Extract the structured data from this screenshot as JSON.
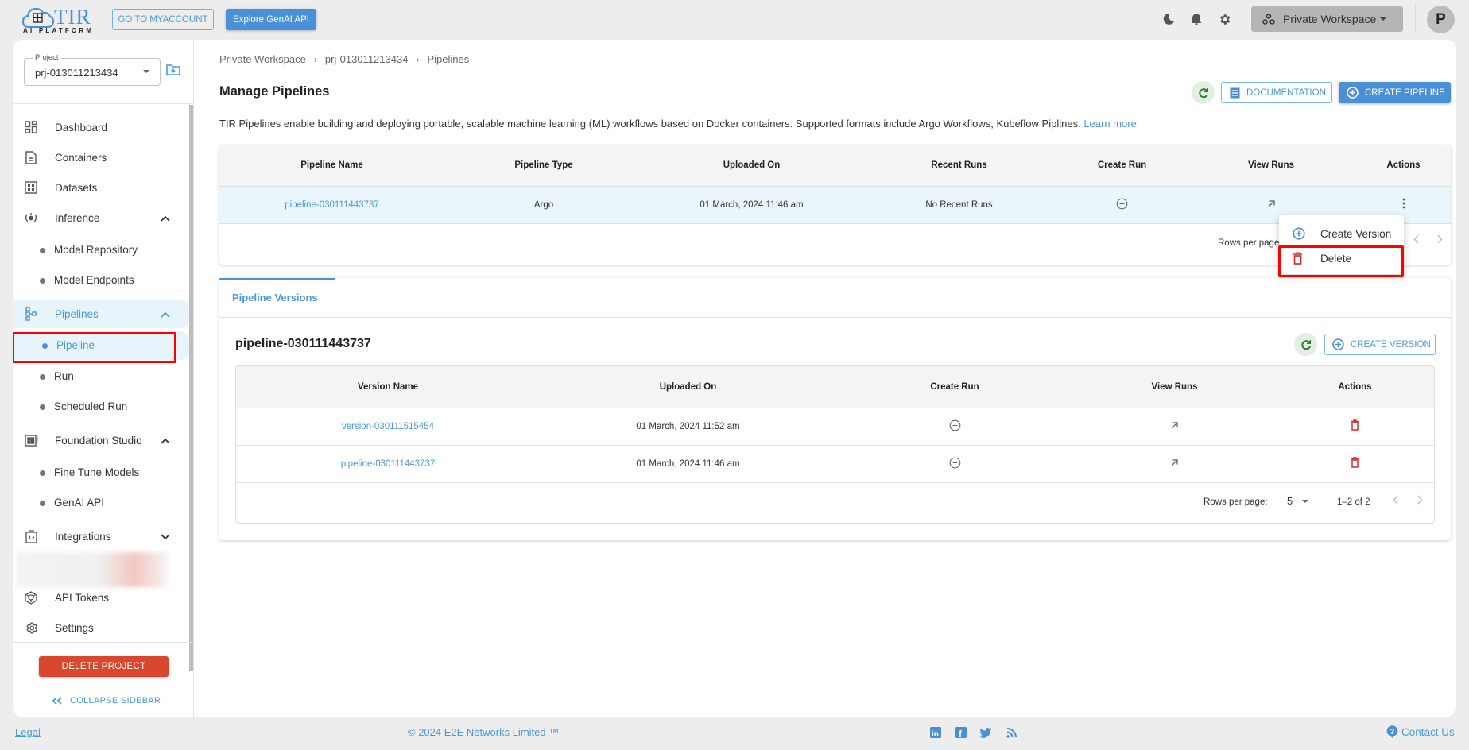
{
  "topbar": {
    "logo_text": "TIR",
    "logo_subtitle": "AI PLATFORM",
    "myaccount_label": "GO TO MYACCOUNT",
    "genai_label": "Explore GenAI API",
    "workspace_label": "Private Workspace",
    "avatar_initial": "P",
    "icons": [
      "moon-icon",
      "bell-icon",
      "gear-icon"
    ]
  },
  "sidebar": {
    "project_label": "Project",
    "project_value": "prj-013011213434",
    "items": [
      {
        "label": "Dashboard",
        "icon": "dashboard-icon"
      },
      {
        "label": "Containers",
        "icon": "document-icon"
      },
      {
        "label": "Datasets",
        "icon": "grid-icon"
      },
      {
        "label": "Inference",
        "icon": "inference-icon",
        "expanded": true
      },
      {
        "label": "Model Repository",
        "sub": true
      },
      {
        "label": "Model Endpoints",
        "sub": true
      },
      {
        "label": "Pipelines",
        "icon": "pipeline-icon",
        "expanded": true,
        "active": true
      },
      {
        "label": "Pipeline",
        "sub": true,
        "active": true
      },
      {
        "label": "Run",
        "sub": true
      },
      {
        "label": "Scheduled Run",
        "sub": true
      },
      {
        "label": "Foundation Studio",
        "icon": "studio-icon",
        "expanded": true
      },
      {
        "label": "Fine Tune Models",
        "sub": true
      },
      {
        "label": "GenAI API",
        "sub": true
      },
      {
        "label": "Integrations",
        "icon": "integrations-icon",
        "expanded": false
      },
      {
        "label": "API Tokens",
        "icon": "token-icon"
      },
      {
        "label": "Settings",
        "icon": "settings-icon"
      }
    ],
    "delete_project_label": "DELETE PROJECT",
    "collapse_label": "COLLAPSE SIDEBAR"
  },
  "breadcrumb": [
    "Private Workspace",
    "prj-013011213434",
    "Pipelines"
  ],
  "page": {
    "title": "Manage Pipelines",
    "documentation_label": "DOCUMENTATION",
    "create_pipeline_label": "CREATE PIPELINE",
    "description": "TIR Pipelines enable building and deploying portable, scalable machine learning (ML) workflows based on Docker containers. Supported formats include Argo Workflows, Kubeflow Piplines.",
    "learn_more": "Learn more"
  },
  "pipelines_table": {
    "columns": [
      "Pipeline Name",
      "Pipeline Type",
      "Uploaded On",
      "Recent Runs",
      "Create Run",
      "View Runs",
      "Actions"
    ],
    "rows": [
      {
        "name": "pipeline-030111443737",
        "type": "Argo",
        "uploaded": "01 March, 2024 11:46 am",
        "recent_runs": "No Recent Runs"
      }
    ],
    "rows_per_page_label": "Rows per page:"
  },
  "actions_menu": {
    "items": [
      {
        "label": "Create Version",
        "icon": "add-circle-icon"
      },
      {
        "label": "Delete",
        "icon": "trash-icon",
        "highlighted": true
      }
    ]
  },
  "versions": {
    "tab_label": "Pipeline Versions",
    "pipeline_name": "pipeline-030111443737",
    "create_version_label": "CREATE VERSION",
    "columns": [
      "Version Name",
      "Uploaded On",
      "Create Run",
      "View Runs",
      "Actions"
    ],
    "rows": [
      {
        "name": "version-030111515454",
        "uploaded": "01 March, 2024 11:52 am"
      },
      {
        "name": "pipeline-030111443737",
        "uploaded": "01 March, 2024 11:46 am"
      }
    ],
    "rows_per_page_label": "Rows per page:",
    "rows_per_page_value": "5",
    "range_label": "1–2 of 2"
  },
  "footer": {
    "legal": "Legal",
    "copyright": "© 2024 E2E Networks Limited ™",
    "contact": "Contact Us",
    "social": [
      "linkedin-icon",
      "facebook-icon",
      "twitter-icon",
      "rss-icon"
    ]
  },
  "colors": {
    "accent": "#4a90d9",
    "link": "#4a9ad8",
    "danger": "#d9472f",
    "highlight_box": "#ff0000",
    "refresh_bg": "#e3efe3"
  }
}
